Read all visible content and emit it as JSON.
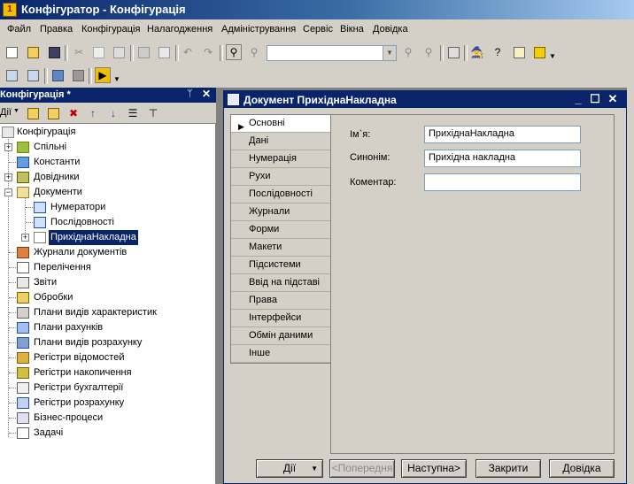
{
  "app": {
    "title": "Конфігуратор - Конфігурація"
  },
  "menu": [
    {
      "label": "Файл"
    },
    {
      "label": "Правка"
    },
    {
      "label": "Конфігурація"
    },
    {
      "label": "Налагодження"
    },
    {
      "label": "Адміністрування"
    },
    {
      "label": "Сервіс"
    },
    {
      "label": "Вікна"
    },
    {
      "label": "Довідка"
    }
  ],
  "config_panel": {
    "title": "Конфігурація *",
    "pin": "ᛘ",
    "actions_label": "Дії",
    "tree": [
      {
        "label": "Конфігурація"
      },
      {
        "label": "Спільні"
      },
      {
        "label": "Константи"
      },
      {
        "label": "Довідники"
      },
      {
        "label": "Документи"
      },
      {
        "label": "Нумератори"
      },
      {
        "label": "Послідовності"
      },
      {
        "label": "ПрихіднаНакладна"
      },
      {
        "label": "Журнали документів"
      },
      {
        "label": "Перелічення"
      },
      {
        "label": "Звіти"
      },
      {
        "label": "Обробки"
      },
      {
        "label": "Плани видів характеристик"
      },
      {
        "label": "Плани рахунків"
      },
      {
        "label": "Плани видів розрахунку"
      },
      {
        "label": "Регістри відомостей"
      },
      {
        "label": "Регістри накопичення"
      },
      {
        "label": "Регістри бухгалтерії"
      },
      {
        "label": "Регістри розрахунку"
      },
      {
        "label": "Бізнес-процеси"
      },
      {
        "label": "Задачі"
      }
    ]
  },
  "doc_window": {
    "title": "Документ ПрихіднаНакладна",
    "tabs": [
      {
        "label": "Основні"
      },
      {
        "label": "Дані"
      },
      {
        "label": "Нумерація"
      },
      {
        "label": "Рухи"
      },
      {
        "label": "Послідовності"
      },
      {
        "label": "Журнали"
      },
      {
        "label": "Форми"
      },
      {
        "label": "Макети"
      },
      {
        "label": "Підсистеми"
      },
      {
        "label": "Ввід на підставі"
      },
      {
        "label": "Права"
      },
      {
        "label": "Інтерфейси"
      },
      {
        "label": "Обмін даними"
      },
      {
        "label": "Інше"
      }
    ],
    "fields": {
      "name_label": "Ім`я:",
      "name_value": "ПрихіднаНакладна",
      "synonym_label": "Синонім:",
      "synonym_value": "Прихідна накладна",
      "comment_label": "Коментар:",
      "comment_value": ""
    },
    "buttons": {
      "actions": "Дії",
      "previous": "<Попередня",
      "next": "Наступна>",
      "close": "Закрити",
      "help": "Довідка"
    }
  }
}
